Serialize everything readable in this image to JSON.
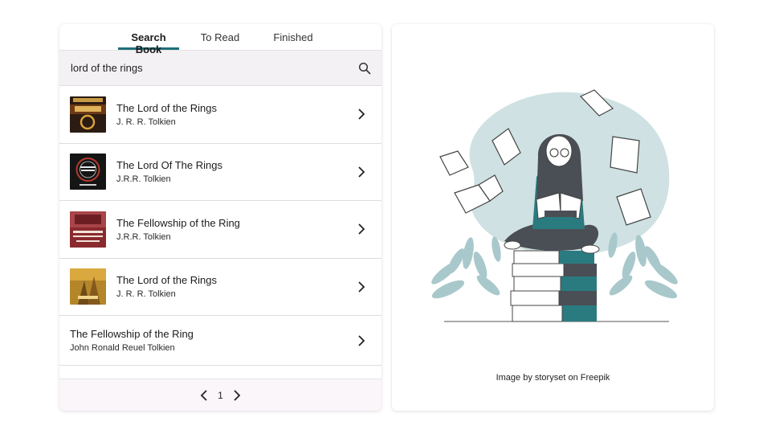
{
  "tabs": [
    {
      "label": "Search Book",
      "active": true
    },
    {
      "label": "To Read",
      "active": false
    },
    {
      "label": "Finished",
      "active": false
    }
  ],
  "search": {
    "value": "lord of the rings",
    "icon": "search-icon"
  },
  "results": [
    {
      "title": "The Lord of the Rings",
      "author": "J. R. R. Tolkien",
      "cover_color": "#2b1b12"
    },
    {
      "title": "The Lord Of The Rings",
      "author": "J.R.R. Tolkien",
      "cover_color": "#151515"
    },
    {
      "title": "The Fellowship of the Ring",
      "author": "J.R.R. Tolkien",
      "cover_color": "#8a2a2e"
    },
    {
      "title": "The Lord of the Rings",
      "author": "J. R. R. Tolkien",
      "cover_color": "#b3862a"
    },
    {
      "title": "The Fellowship of the Ring",
      "author": "John Ronald Reuel Tolkien",
      "cover_color": null
    }
  ],
  "pagination": {
    "current_page": "1"
  },
  "illustration": {
    "credit": "Image by storyset on Freepik",
    "accent_color": "#2a7b80",
    "blob_color": "#cfe1e2"
  },
  "colors": {
    "tab_underline": "#1f6f78",
    "search_bg": "#f3f1f3",
    "pager_bg": "#faf6fa"
  }
}
